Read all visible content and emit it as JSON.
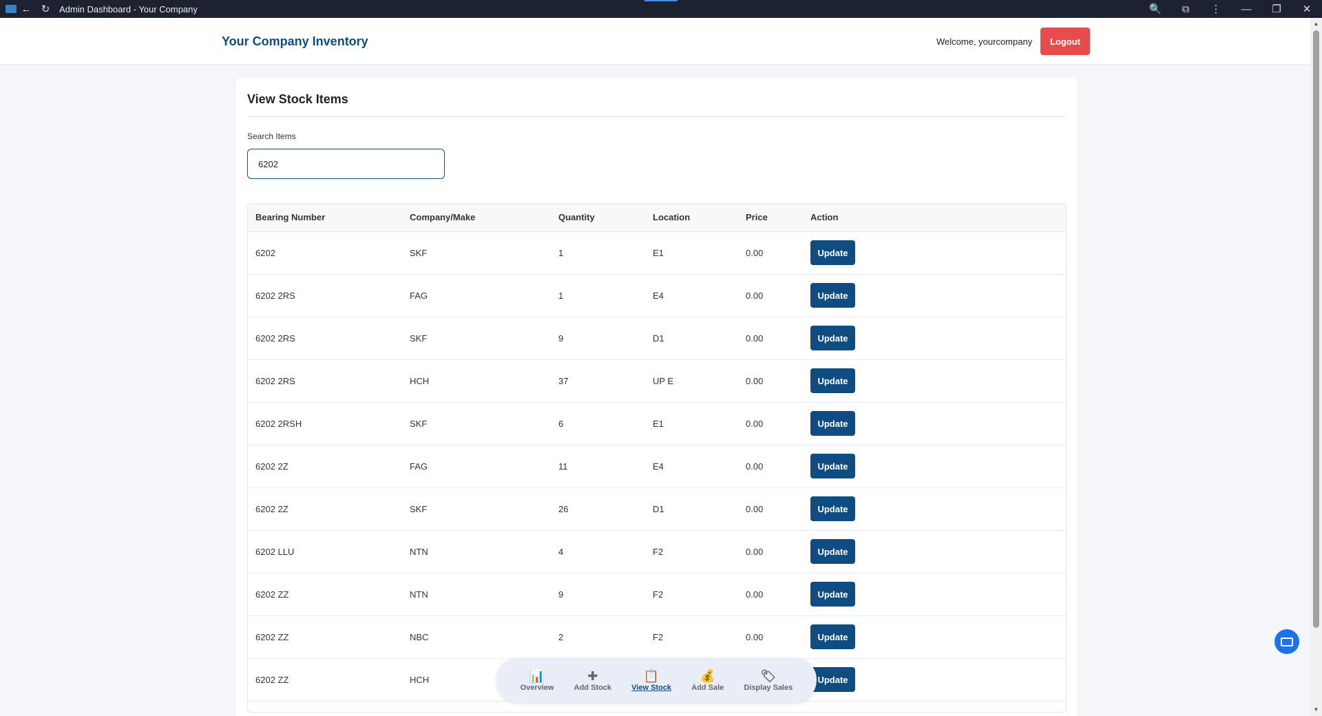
{
  "browser": {
    "title": "Admin Dashboard - Your Company"
  },
  "header": {
    "brand": "Your Company Inventory",
    "welcome": "Welcome, yourcompany",
    "logout_label": "Logout"
  },
  "page": {
    "title": "View Stock Items",
    "search_label": "Search Items",
    "search_value": "6202"
  },
  "table": {
    "columns": [
      "Bearing Number",
      "Company/Make",
      "Quantity",
      "Location",
      "Price",
      "Action"
    ],
    "rows": [
      [
        "6202",
        "SKF",
        "1",
        "E1",
        "0.00",
        "Update"
      ],
      [
        "6202 2RS",
        "FAG",
        "1",
        "E4",
        "0.00",
        "Update"
      ],
      [
        "6202 2RS",
        "SKF",
        "9",
        "D1",
        "0.00",
        "Update"
      ],
      [
        "6202 2RS",
        "HCH",
        "37",
        "UP E",
        "0.00",
        "Update"
      ],
      [
        "6202 2RSH",
        "SKF",
        "6",
        "E1",
        "0.00",
        "Update"
      ],
      [
        "6202 2Z",
        "FAG",
        "11",
        "E4",
        "0.00",
        "Update"
      ],
      [
        "6202 2Z",
        "SKF",
        "26",
        "D1",
        "0.00",
        "Update"
      ],
      [
        "6202 LLU",
        "NTN",
        "4",
        "F2",
        "0.00",
        "Update"
      ],
      [
        "6202 ZZ",
        "NTN",
        "9",
        "F2",
        "0.00",
        "Update"
      ],
      [
        "6202 ZZ",
        "NBC",
        "2",
        "F2",
        "0.00",
        "Update"
      ],
      [
        "6202 ZZ",
        "HCH",
        "",
        "",
        "0.00",
        "Update"
      ]
    ]
  },
  "bottom_nav": {
    "items": [
      {
        "label": "Overview",
        "icon": "📊"
      },
      {
        "label": "Add Stock",
        "icon": "✚"
      },
      {
        "label": "View Stock",
        "icon": "📋"
      },
      {
        "label": "Add Sale",
        "icon": "💰"
      },
      {
        "label": "Display Sales",
        "icon": "🏷"
      }
    ]
  },
  "colors": {
    "brand": "#0f4c81",
    "logout": "#e84b4b",
    "button": "#0f4c81"
  }
}
